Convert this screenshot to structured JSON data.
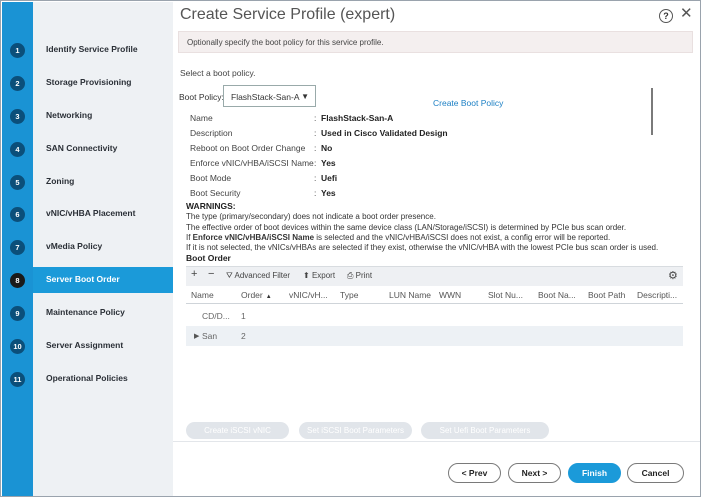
{
  "dialog": {
    "title": "Create Service Profile (expert)",
    "help": "?",
    "close": "✕"
  },
  "steps": [
    {
      "num": "1",
      "label": "Identify Service Profile"
    },
    {
      "num": "2",
      "label": "Storage Provisioning"
    },
    {
      "num": "3",
      "label": "Networking"
    },
    {
      "num": "4",
      "label": "SAN Connectivity"
    },
    {
      "num": "5",
      "label": "Zoning"
    },
    {
      "num": "6",
      "label": "vNIC/vHBA Placement"
    },
    {
      "num": "7",
      "label": "vMedia Policy"
    },
    {
      "num": "8",
      "label": "Server Boot Order"
    },
    {
      "num": "9",
      "label": "Maintenance Policy"
    },
    {
      "num": "10",
      "label": "Server Assignment"
    },
    {
      "num": "11",
      "label": "Operational Policies"
    }
  ],
  "content": {
    "info": "Optionally specify the boot policy for this service profile.",
    "select_text": "Select a boot policy.",
    "boot_policy_label": "Boot Policy:",
    "boot_policy_value": "FlashStack-San-A",
    "create_link": "Create Boot Policy",
    "properties": [
      {
        "k": "Name",
        "v": "FlashStack-San-A"
      },
      {
        "k": "Description",
        "v": "Used in Cisco Validated Design"
      },
      {
        "k": "Reboot on Boot Order Change",
        "v": "No"
      },
      {
        "k": "Enforce vNIC/vHBA/iSCSI Name",
        "v": "Yes"
      },
      {
        "k": "Boot Mode",
        "v": "Uefi"
      },
      {
        "k": "Boot Security",
        "v": "Yes"
      }
    ],
    "colon": ":",
    "warnings_title": "WARNINGS:",
    "warn1": "The type (primary/secondary) does not indicate a boot order presence.",
    "warn2": "The effective order of boot devices within the same device class (LAN/Storage/iSCSI) is determined by PCIe bus scan order.",
    "warn3_pre": "If ",
    "warn3_bold": "Enforce vNIC/vHBA/iSCSI Name",
    "warn3_post": " is selected and the vNIC/vHBA/iSCSI does not exist, a config error will be reported.",
    "warn4": "If it is not selected, the vNICs/vHBAs are selected if they exist, otherwise the vNIC/vHBA with the lowest PCIe bus scan order is used.",
    "boot_order_title": "Boot Order"
  },
  "table": {
    "toolbar": {
      "add": "+",
      "remove": "−",
      "filter_icon": "⛛",
      "filter": "Advanced Filter",
      "export_icon": "⬆",
      "export": "Export",
      "print_icon": "⎙",
      "print": "Print",
      "settings_icon": "⚙"
    },
    "columns": [
      "Name",
      "Order",
      "vNIC/vH...",
      "Type",
      "LUN Name",
      "WWN",
      "Slot Nu...",
      "Boot Na...",
      "Boot Path",
      "Descripti..."
    ],
    "sort_arrow": "▲",
    "rows": [
      {
        "name": "CD/D...",
        "order": "1"
      },
      {
        "name": "San",
        "order": "2"
      }
    ],
    "expander": "▶"
  },
  "action_buttons": [
    "Create iSCSI vNIC",
    "Set iSCSI Boot Parameters",
    "Set Uefi Boot Parameters"
  ],
  "footer": {
    "prev": "< Prev",
    "next": "Next >",
    "finish": "Finish",
    "cancel": "Cancel"
  }
}
